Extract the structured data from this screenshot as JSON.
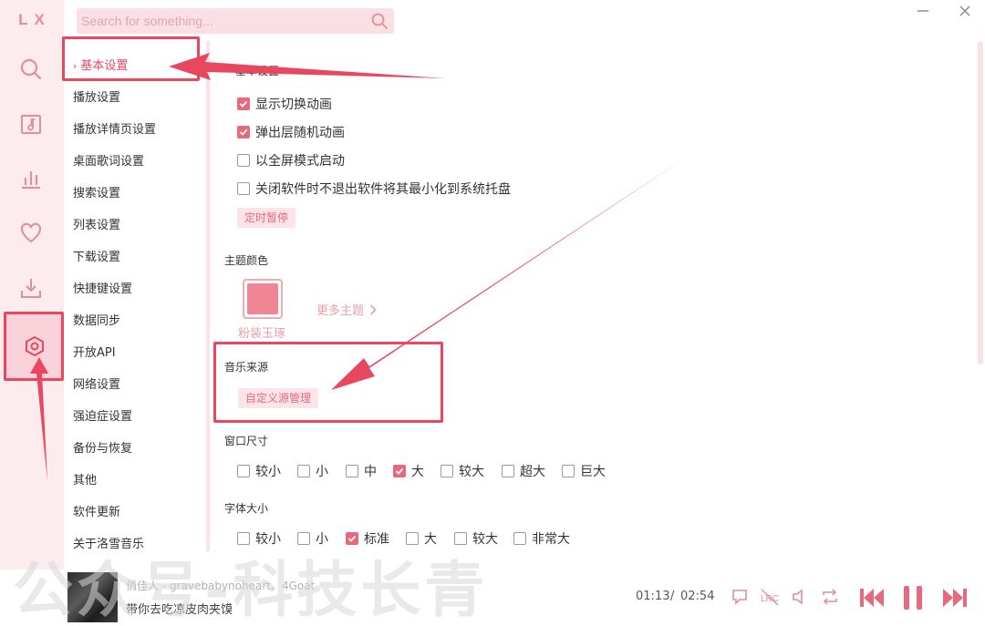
{
  "app": {
    "logo": "LX"
  },
  "search": {
    "placeholder": "Search for something..."
  },
  "nav": {
    "items": [
      {
        "label": "基本设置",
        "active": true
      },
      {
        "label": "播放设置"
      },
      {
        "label": "播放详情页设置"
      },
      {
        "label": "桌面歌词设置"
      },
      {
        "label": "搜索设置"
      },
      {
        "label": "列表设置"
      },
      {
        "label": "下载设置"
      },
      {
        "label": "快捷键设置"
      },
      {
        "label": "数据同步"
      },
      {
        "label": "开放API"
      },
      {
        "label": "网络设置"
      },
      {
        "label": "强迫症设置"
      },
      {
        "label": "备份与恢复"
      },
      {
        "label": "其他"
      },
      {
        "label": "软件更新"
      },
      {
        "label": "关于洛雪音乐"
      }
    ]
  },
  "basic": {
    "title": "基本设置",
    "options": [
      {
        "label": "显示切换动画",
        "checked": true
      },
      {
        "label": "弹出层随机动画",
        "checked": true
      },
      {
        "label": "以全屏模式启动",
        "checked": false
      },
      {
        "label": "关闭软件时不退出软件将其最小化到系统托盘",
        "checked": false
      }
    ],
    "timer_button": "定时暂停"
  },
  "theme": {
    "title": "主题颜色",
    "current_name": "粉装玉琢",
    "current_color": "#f08593",
    "more_label": "更多主题"
  },
  "music_source": {
    "title": "音乐来源",
    "button": "自定义源管理"
  },
  "window_size": {
    "title": "窗口尺寸",
    "options": [
      {
        "label": "较小",
        "checked": false
      },
      {
        "label": "小",
        "checked": false
      },
      {
        "label": "中",
        "checked": false
      },
      {
        "label": "大",
        "checked": true
      },
      {
        "label": "较大",
        "checked": false
      },
      {
        "label": "超大",
        "checked": false
      },
      {
        "label": "巨大",
        "checked": false
      }
    ]
  },
  "font_size": {
    "title": "字体大小",
    "options": [
      {
        "label": "较小",
        "checked": false
      },
      {
        "label": "小",
        "checked": false
      },
      {
        "label": "标准",
        "checked": true
      },
      {
        "label": "大",
        "checked": false
      },
      {
        "label": "较大",
        "checked": false
      },
      {
        "label": "非常大",
        "checked": false
      }
    ]
  },
  "player": {
    "artist": "俏佳人 - gravebabynoheart、4Goat",
    "title": "带你去吃凉皮肉夹馍",
    "time_current": "01:13",
    "time_separator": "/",
    "time_total": "02:54"
  },
  "watermark": "公众号-科技长青",
  "colors": {
    "accent": "#e66a7c",
    "annotation": "#e8475f",
    "rail_bg": "#fcecee"
  }
}
